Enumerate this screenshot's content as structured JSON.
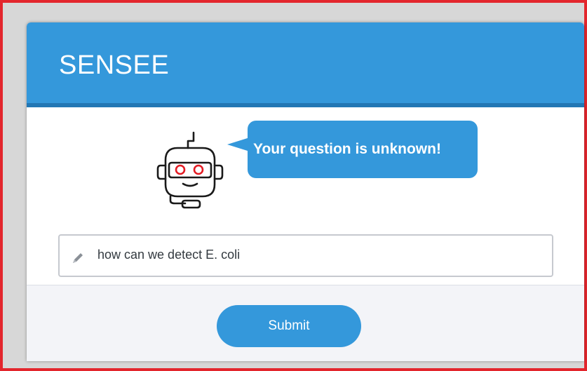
{
  "app": {
    "title": "SENSEE"
  },
  "bot": {
    "icon": "robot-headset-icon",
    "message": "Your question is unknown!"
  },
  "question_input": {
    "icon": "pencil-icon",
    "value": "how can we detect E. coli"
  },
  "actions": {
    "submit_label": "Submit"
  },
  "colors": {
    "accent": "#3498db",
    "header_rule": "#2277b4",
    "robot_eyes": "#e31b23",
    "window_border": "#e3262d",
    "footer_bg": "#f3f4f8"
  }
}
